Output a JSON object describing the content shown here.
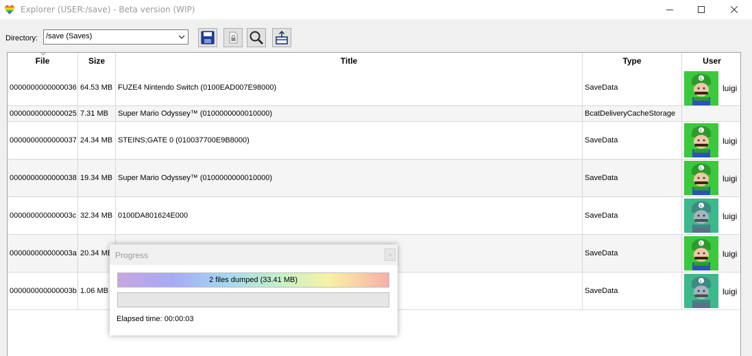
{
  "window": {
    "title": "Explorer (USER:/save) - Beta version (WIP)"
  },
  "toolbar": {
    "directory_label": "Directory:",
    "directory_value": "/save (Saves)",
    "buttons": [
      "save-icon",
      "lock-icon",
      "search-icon",
      "export-box-icon"
    ]
  },
  "table": {
    "columns": [
      "File",
      "Size",
      "Title",
      "Type",
      "User"
    ],
    "rows": [
      {
        "file": "0000000000000036",
        "size": "64.53 MB",
        "title": "FUZE4 Nintendo Switch (0100EAD007E98000)",
        "type": "SaveData",
        "user": "luigi",
        "avatar": "bright"
      },
      {
        "file": "0000000000000025",
        "size": "7.31 MB",
        "title": "Super Mario Odyssey™ (0100000000010000)",
        "type": "BcatDeliveryCacheStorage",
        "user": "",
        "avatar": ""
      },
      {
        "file": "0000000000000037",
        "size": "24.34 MB",
        "title": "STEINS;GATE 0 (010037700E9B8000)",
        "type": "SaveData",
        "user": "luigi",
        "avatar": "bright"
      },
      {
        "file": "0000000000000038",
        "size": "19.34 MB",
        "title": "Super Mario Odyssey™ (0100000000010000)",
        "type": "SaveData",
        "user": "luigi",
        "avatar": "bright"
      },
      {
        "file": "000000000000003c",
        "size": "32.34 MB",
        "title": "0100DA801624E000",
        "type": "SaveData",
        "user": "luigi",
        "avatar": "muted"
      },
      {
        "file": "000000000000003a",
        "size": "20.34 MB",
        "title": "",
        "type": "SaveData",
        "user": "luigi",
        "avatar": "bright"
      },
      {
        "file": "000000000000003b",
        "size": "1.06 MB",
        "title": "",
        "type": "SaveData",
        "user": "luigi",
        "avatar": "muted"
      }
    ]
  },
  "progress_dialog": {
    "title": "Progress",
    "close_label": "×",
    "bar1_text": "2 files dumped (33.41 MB)",
    "bar1_progress": 1.0,
    "bar2_text": "",
    "bar2_progress": 0,
    "elapsed": "Elapsed time: 00:00:03"
  },
  "colors": {
    "accent_green": "#3cc83c",
    "muted_green": "#3cb88a",
    "save_blue": "#1e3fa0"
  }
}
